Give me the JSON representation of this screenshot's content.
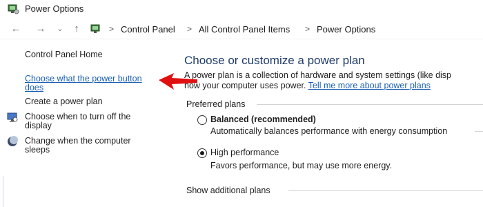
{
  "window": {
    "title": "Power Options"
  },
  "nav": {
    "back_icon": "back-arrow-icon",
    "forward_icon": "forward-arrow-icon",
    "recent_icon": "chevron-down-icon",
    "up_icon": "up-arrow-icon",
    "breadcrumbs": [
      "Control Panel",
      "All Control Panel Items",
      "Power Options"
    ],
    "separator": ">"
  },
  "sidebar": {
    "home": "Control Panel Home",
    "items": [
      {
        "label_line1": "Choose what the power button",
        "label_line2": "does"
      },
      {
        "label": "Create a power plan"
      },
      {
        "label_line1": "Choose when to turn off the",
        "label_line2": "display",
        "icon": "monitor-icon"
      },
      {
        "label_line1": "Change when the computer",
        "label_line2": "sleeps",
        "icon": "moon-icon"
      }
    ]
  },
  "main": {
    "title": "Choose or customize a power plan",
    "desc_line1": "A power plan is a collection of hardware and system settings (like disp",
    "desc_line2_prefix": "how your computer uses power. ",
    "desc_link": "Tell me more about power plans",
    "preferred_label": "Preferred plans",
    "plans": [
      {
        "name": "Balanced (recommended)",
        "desc": "Automatically balances performance with energy consumption",
        "selected": false
      },
      {
        "name": "High performance",
        "desc": "Favors performance, but may use more energy.",
        "selected": true
      }
    ],
    "additional_label": "Show additional plans"
  },
  "colors": {
    "link": "#1a5fb4",
    "title": "#1e3b6a",
    "annotation_arrow": "#e01010"
  }
}
